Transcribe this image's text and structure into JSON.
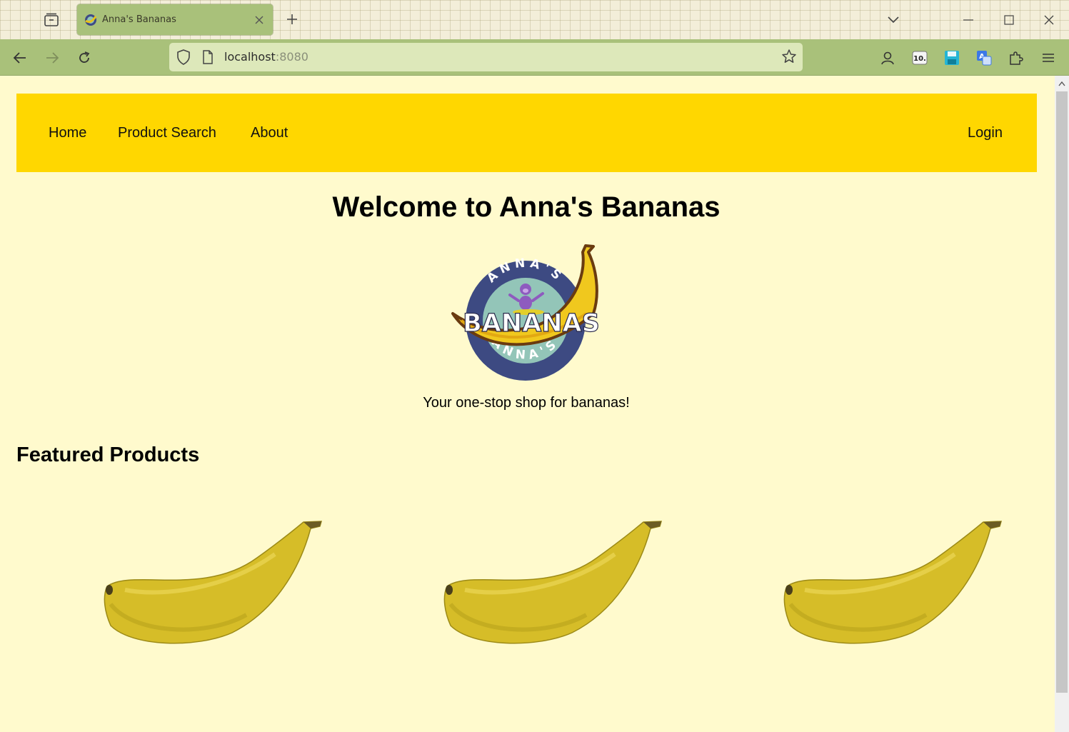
{
  "browser": {
    "tab_title": "Anna's Bananas",
    "url_host": "localhost",
    "url_port": ":8080"
  },
  "site": {
    "nav": {
      "home": "Home",
      "search": "Product Search",
      "about": "About",
      "login": "Login"
    },
    "welcome_title": "Welcome to Anna's Bananas",
    "logo": {
      "top_text": "ANNA'S",
      "bottom_text": "ANNA'S",
      "word": "BANANAS"
    },
    "tagline": "Your one-stop shop for bananas!",
    "featured_heading": "Featured Products",
    "products": [
      {
        "image": "banana"
      },
      {
        "image": "banana"
      },
      {
        "image": "banana"
      }
    ]
  },
  "colors": {
    "page_bg": "#fffacd",
    "nav_bg": "#ffd700",
    "browser_accent": "#a9c17a"
  }
}
